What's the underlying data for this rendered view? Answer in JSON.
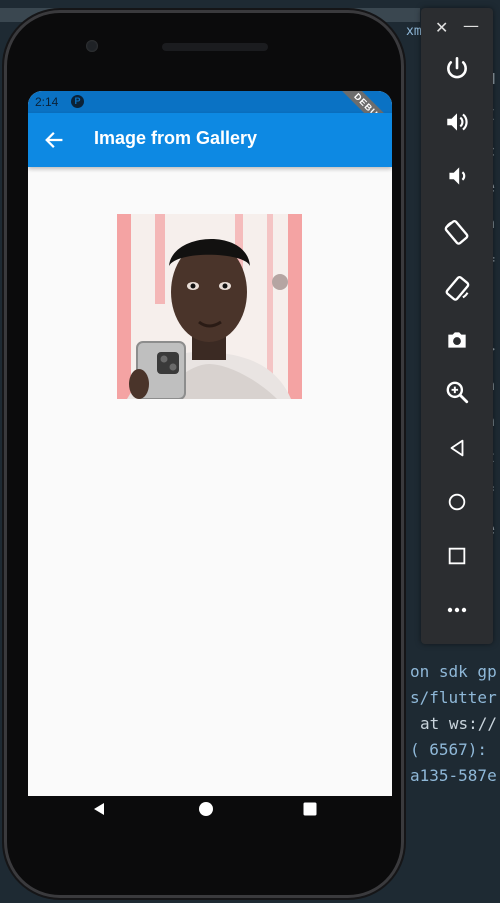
{
  "ide": {
    "lines": [
      "on sdk gp",
      "s/flutter",
      "at ws://",
      "( 6567):",
      "a135-587e"
    ],
    "top_tab": "xm"
  },
  "emulator_toolbar": {
    "close": "✕",
    "minimize": "—",
    "buttons": [
      "power-icon",
      "volume-up-icon",
      "volume-down-icon",
      "rotate-left-icon",
      "rotate-right-icon",
      "camera-icon",
      "zoom-icon",
      "back-icon",
      "home-icon",
      "overview-icon",
      "more-icon"
    ]
  },
  "phone": {
    "status": {
      "time": "2:14",
      "app_icon_letter": "P"
    },
    "debug_banner": "DEBUG",
    "appbar": {
      "title": "Image from Gallery"
    },
    "colors": {
      "appbar": "#0d89e3",
      "statusbar": "#0a72c4",
      "background": "#fafafa"
    }
  }
}
